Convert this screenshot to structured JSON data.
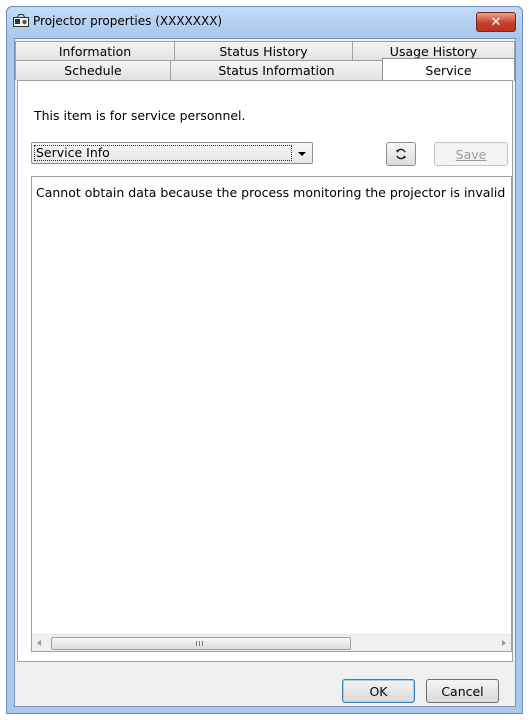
{
  "window": {
    "title": "Projector properties (XXXXXXX)",
    "close_glyph": "✕"
  },
  "tabs": {
    "row1": [
      "Information",
      "Status History",
      "Usage History"
    ],
    "row2": [
      "Schedule",
      "Status Information",
      "Service"
    ],
    "active": "Service"
  },
  "service": {
    "description": "This item is for service personnel.",
    "dropdown_value": "Service Info",
    "save_label": "Save",
    "output_text": "Cannot obtain data because the process monitoring the projector is invalid"
  },
  "footer": {
    "ok_label": "OK",
    "cancel_label": "Cancel"
  },
  "icons": {
    "app": "projector-app-icon",
    "refresh": "refresh-icon"
  },
  "colors": {
    "frame": "#a9c8ec",
    "close": "#c7422c"
  }
}
